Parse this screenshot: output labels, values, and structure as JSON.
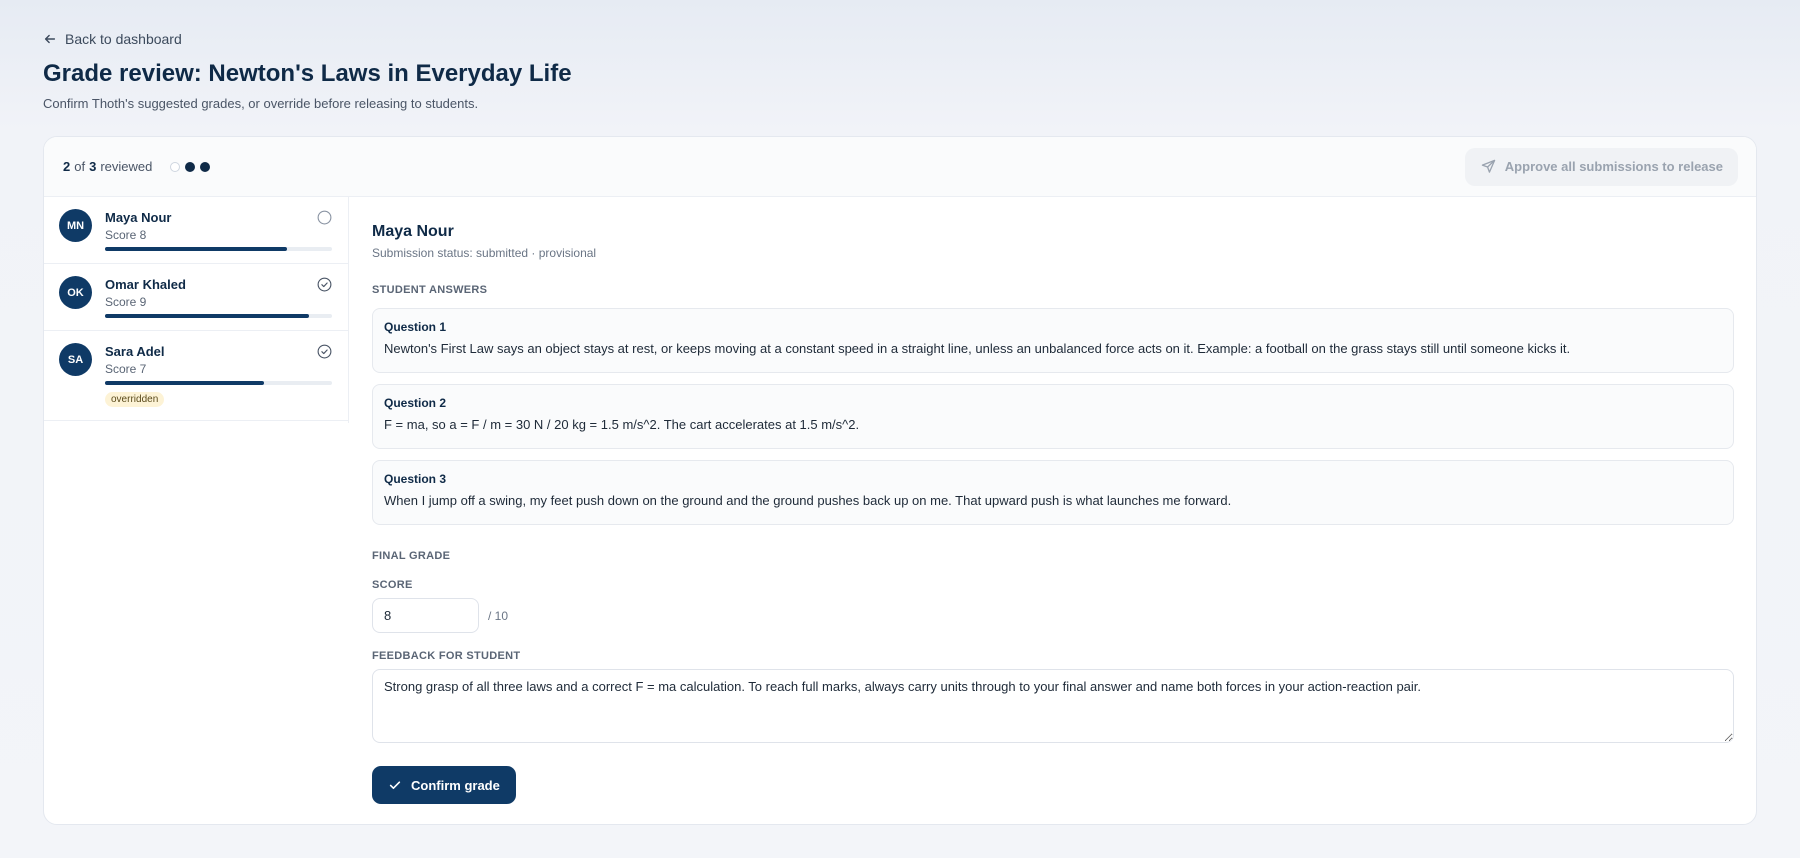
{
  "nav": {
    "back_label": "Back to dashboard"
  },
  "header": {
    "title": "Grade review: Newton's Laws in Everyday Life",
    "subtitle": "Confirm Thoth's suggested grades, or override before releasing to students."
  },
  "progress": {
    "reviewed": "2",
    "of": "of",
    "total": "3",
    "suffix": "reviewed"
  },
  "approve_button": {
    "label": "Approve all submissions to release"
  },
  "students": [
    {
      "initials": "MN",
      "name": "Maya Nour",
      "score_label": "Score 8",
      "score": 8,
      "max": 10,
      "reviewed": false,
      "badge": ""
    },
    {
      "initials": "OK",
      "name": "Omar Khaled",
      "score_label": "Score 9",
      "score": 9,
      "max": 10,
      "reviewed": true,
      "badge": ""
    },
    {
      "initials": "SA",
      "name": "Sara Adel",
      "score_label": "Score 7",
      "score": 7,
      "max": 10,
      "reviewed": true,
      "badge": "overridden"
    }
  ],
  "selected": {
    "name": "Maya Nour",
    "status": "Submission status: submitted · provisional",
    "answers_label": "STUDENT ANSWERS",
    "answers": [
      {
        "title": "Question 1",
        "text": "Newton's First Law says an object stays at rest, or keeps moving at a constant speed in a straight line, unless an unbalanced force acts on it. Example: a football on the grass stays still until someone kicks it."
      },
      {
        "title": "Question 2",
        "text": "F = ma, so a = F / m = 30 N / 20 kg = 1.5 m/s^2. The cart accelerates at 1.5 m/s^2."
      },
      {
        "title": "Question 3",
        "text": "When I jump off a swing, my feet push down on the ground and the ground pushes back up on me. That upward push is what launches me forward."
      }
    ],
    "final_grade_label": "FINAL GRADE",
    "score_label": "SCORE",
    "score_value": "8",
    "score_max": "/ 10",
    "feedback_label": "FEEDBACK FOR STUDENT",
    "feedback_value": "Strong grasp of all three laws and a correct F = ma calculation. To reach full marks, always carry units through to your final answer and name both forces in your action-reaction pair.",
    "confirm_label": "Confirm grade"
  },
  "colors": {
    "primary": "#0f3a66",
    "badge_bg": "#fdf3d6"
  }
}
